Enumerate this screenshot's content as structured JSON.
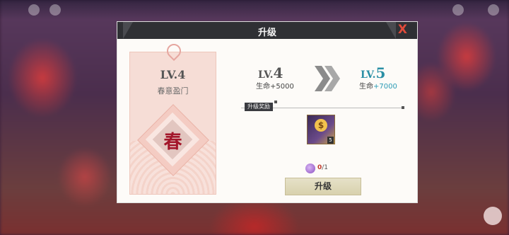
{
  "modal": {
    "title": "升级",
    "close_label": "X"
  },
  "card": {
    "level": "LV.4",
    "name": "春意盈门",
    "emblem_char": "春"
  },
  "current": {
    "level_prefix": "LV.",
    "level_num": "4",
    "stat": "生命+5000"
  },
  "next": {
    "level_prefix": "LV.",
    "level_num": "5",
    "stat_label": "生命",
    "stat_bonus": "+7000"
  },
  "reward": {
    "label": "升级奖励",
    "item_count": "5"
  },
  "cost": {
    "owned": "0",
    "required": "/1"
  },
  "button": {
    "upgrade_label": "升级"
  },
  "icons": [
    "close-icon",
    "double-chevron-right-icon",
    "reward-item-icon",
    "currency-coin-icon"
  ]
}
